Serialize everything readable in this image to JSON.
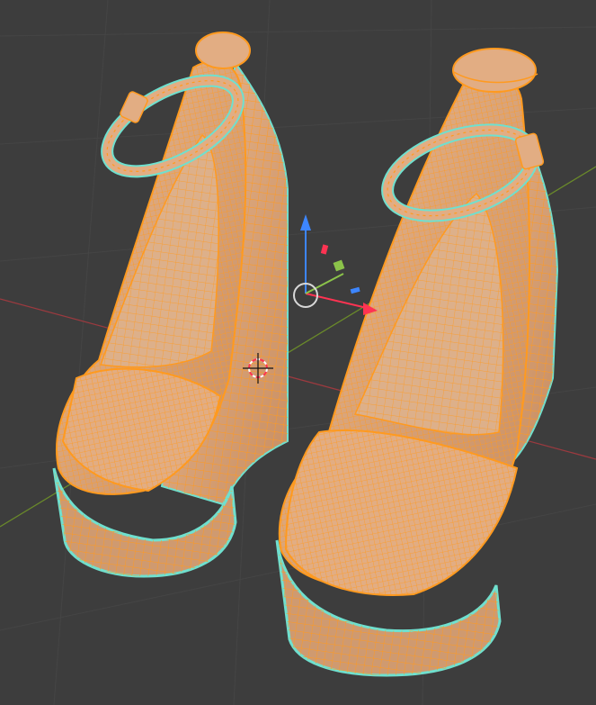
{
  "viewport": {
    "background": "#3d3d3d",
    "grid_color": "#454545",
    "x_axis_color": "#9b3a3f",
    "y_axis_color": "#6a8a2a"
  },
  "objects": [
    {
      "name": "wedge-sandal-left",
      "selected": true,
      "mode": "edit-wireframe-overlay"
    },
    {
      "name": "wedge-sandal-right",
      "selected": true,
      "mode": "edit-wireframe-overlay"
    }
  ],
  "colors": {
    "mesh_fill": "#e8b48a",
    "mesh_shadow": "#c98f63",
    "wire": "#ff9a1f",
    "selection_outline": "#6fe0cf"
  },
  "gizmo": {
    "icon": "transform-gizmo-icon",
    "z_arrow_color": "#3d86ff",
    "x_arrow_color": "#ff3352",
    "y_handle_color": "#8bc34a",
    "plane_handles": [
      "#ff3352",
      "#8bc34a",
      "#3d86ff"
    ]
  },
  "cursor": {
    "icon": "3d-cursor-icon"
  }
}
